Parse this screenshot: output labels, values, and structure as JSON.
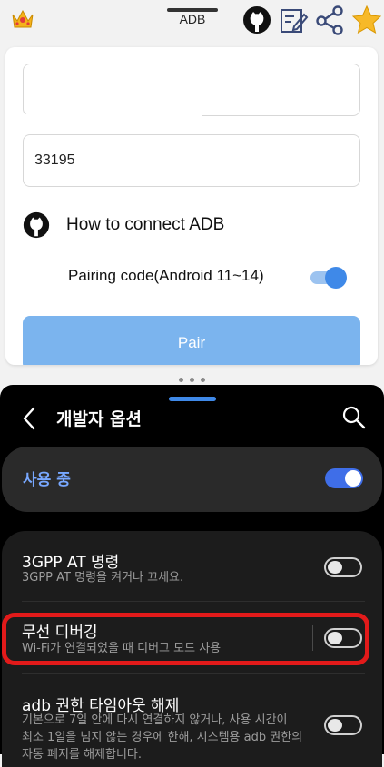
{
  "top_bar": {
    "title": "ADB",
    "icons": [
      "crown-icon",
      "github-icon",
      "edit-note-icon",
      "share-icon",
      "star-icon"
    ]
  },
  "card": {
    "field1_value": "",
    "field2_value": "33195",
    "how_to": "How to connect ADB",
    "pairing_label": "Pairing code(Android 11~14)",
    "pairing_enabled": true,
    "pair_button": "Pair"
  },
  "settings": {
    "title": "개발자 옵션",
    "in_use": {
      "label": "사용 중",
      "enabled": true
    },
    "items": [
      {
        "title": "3GPP AT 명령",
        "subtitle": "3GPP AT 명령을 켜거나 끄세요.",
        "enabled": false
      },
      {
        "title": "무선 디버깅",
        "subtitle": "Wi-Fi가 연결되었을 때 디버그 모드 사용",
        "enabled": false
      },
      {
        "title": "adb 권한 타임아웃 해제",
        "subtitle_lines": [
          "기본으로 7일 안에 다시 연결하지 않거나, 사용 시간이",
          "최소 1일을 넘지 않는 경우에 한해, 시스템용 adb 권한의",
          "자동 폐지를 해제합니다."
        ],
        "enabled": false
      }
    ]
  },
  "colors": {
    "accent_blue": "#3f89e8",
    "pair_button": "#7bb4ee",
    "in_use_text": "#78a8ff",
    "highlight_red": "#e21a1a",
    "dark_bg": "#000000"
  }
}
